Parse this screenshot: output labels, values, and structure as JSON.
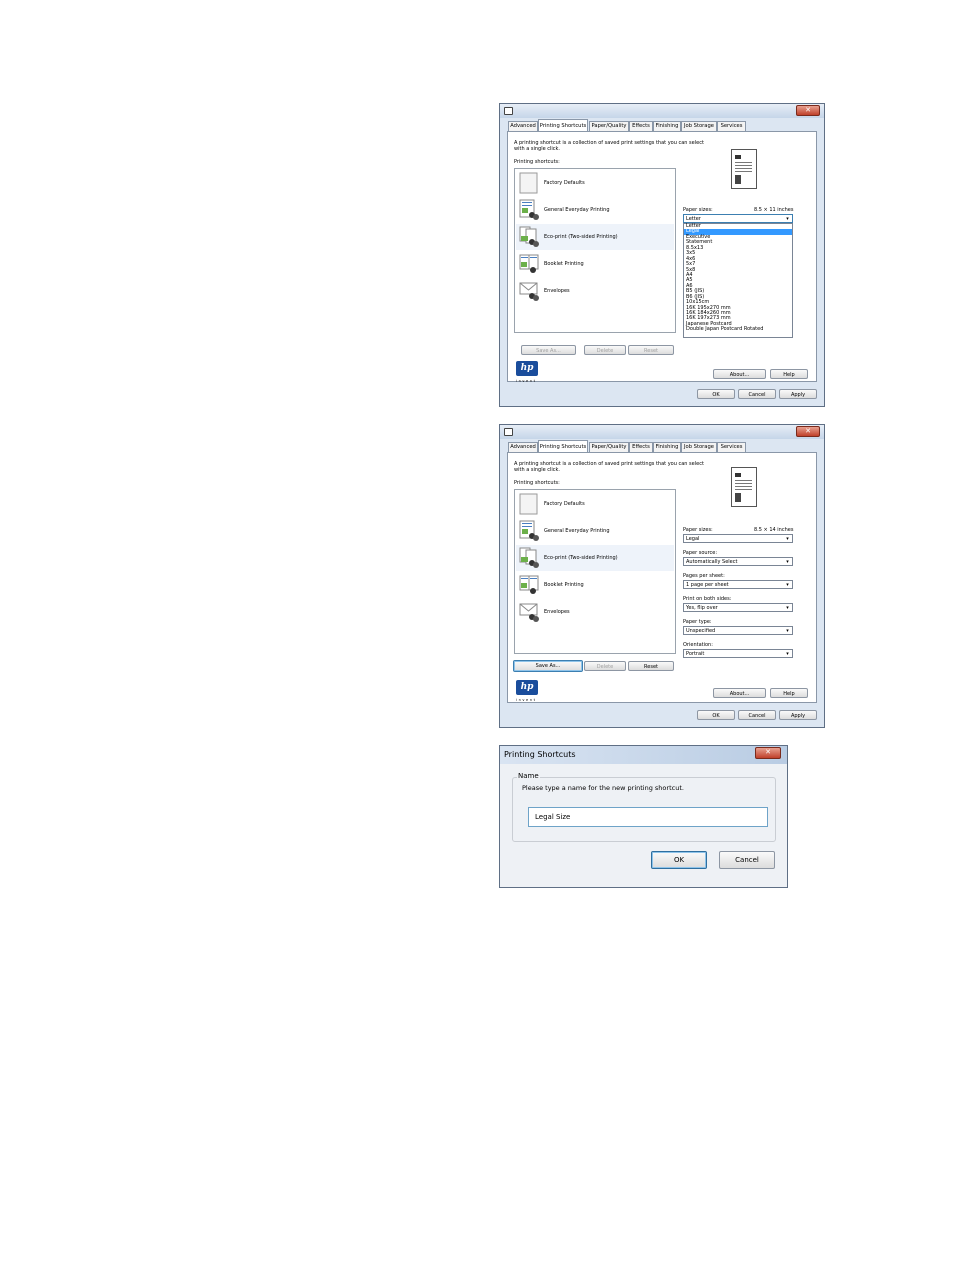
{
  "dialog1": {
    "tabs": [
      "Advanced",
      "Printing Shortcuts",
      "Paper/Quality",
      "Effects",
      "Finishing",
      "Job Storage",
      "Services"
    ],
    "description": [
      "A printing shortcut is a collection of saved print settings that you can select",
      "with a single click."
    ],
    "shortcuts_label": "Printing shortcuts:",
    "shortcuts": [
      {
        "label": "Factory Defaults",
        "icon": "blank-page-icon"
      },
      {
        "label": "General Everyday Printing",
        "icon": "document-people-icon"
      },
      {
        "label": "Eco-print (Two-sided Printing)",
        "icon": "duplex-people-icon"
      },
      {
        "label": "Booklet Printing",
        "icon": "booklet-people-icon"
      },
      {
        "label": "Envelopes",
        "icon": "envelope-people-icon"
      }
    ],
    "paper_sizes_label": "Paper sizes:",
    "paper_size_dims": "8.5 × 11 inches",
    "paper_size_value": "Letter",
    "dropdown_options": [
      "Letter",
      "Legal",
      "Executive",
      "Statement",
      "8.5x13",
      "3x5",
      "4x6",
      "5x7",
      "5x8",
      "A4",
      "A5",
      "A6",
      "B5 (JIS)",
      "B6 (JIS)",
      "10x15cm",
      "16K 195x270 mm",
      "16K 184x260 mm",
      "16K 197x273 mm",
      "Japanese Postcard",
      "Double Japan Postcard Rotated"
    ],
    "highlighted_option": "Legal",
    "buttons": {
      "save_as": "Save As...",
      "delete": "Delete",
      "reset": "Reset",
      "about": "About...",
      "help": "Help",
      "ok": "OK",
      "cancel": "Cancel",
      "apply": "Apply"
    },
    "logo_text": "hp",
    "logo_subtext": "invent"
  },
  "dialog2": {
    "tabs": [
      "Advanced",
      "Printing Shortcuts",
      "Paper/Quality",
      "Effects",
      "Finishing",
      "Job Storage",
      "Services"
    ],
    "description": [
      "A printing shortcut is a collection of saved print settings that you can select",
      "with a single click."
    ],
    "shortcuts_label": "Printing shortcuts:",
    "shortcuts": [
      {
        "label": "Factory Defaults",
        "icon": "blank-page-icon"
      },
      {
        "label": "General Everyday Printing",
        "icon": "document-people-icon"
      },
      {
        "label": "Eco-print (Two-sided Printing)",
        "icon": "duplex-people-icon"
      },
      {
        "label": "Booklet Printing",
        "icon": "booklet-people-icon"
      },
      {
        "label": "Envelopes",
        "icon": "envelope-people-icon"
      }
    ],
    "settings": [
      {
        "label": "Paper sizes:",
        "value": "Legal",
        "extra": "8.5 × 14 inches"
      },
      {
        "label": "Paper source:",
        "value": "Automatically Select"
      },
      {
        "label": "Pages per sheet:",
        "value": "1 page per sheet"
      },
      {
        "label": "Print on both sides:",
        "value": "Yes, flip over"
      },
      {
        "label": "Paper type:",
        "value": "Unspecified"
      },
      {
        "label": "Orientation:",
        "value": "Portrait"
      }
    ],
    "buttons": {
      "save_as": "Save As...",
      "delete": "Delete",
      "reset": "Reset",
      "about": "About...",
      "help": "Help",
      "ok": "OK",
      "cancel": "Cancel",
      "apply": "Apply"
    },
    "logo_text": "hp",
    "logo_subtext": "invent"
  },
  "dialog3": {
    "title": "Printing Shortcuts",
    "group_label": "Name",
    "prompt": "Please type a name for the new printing shortcut.",
    "name_value": "Legal Size",
    "ok": "OK",
    "cancel": "Cancel"
  }
}
